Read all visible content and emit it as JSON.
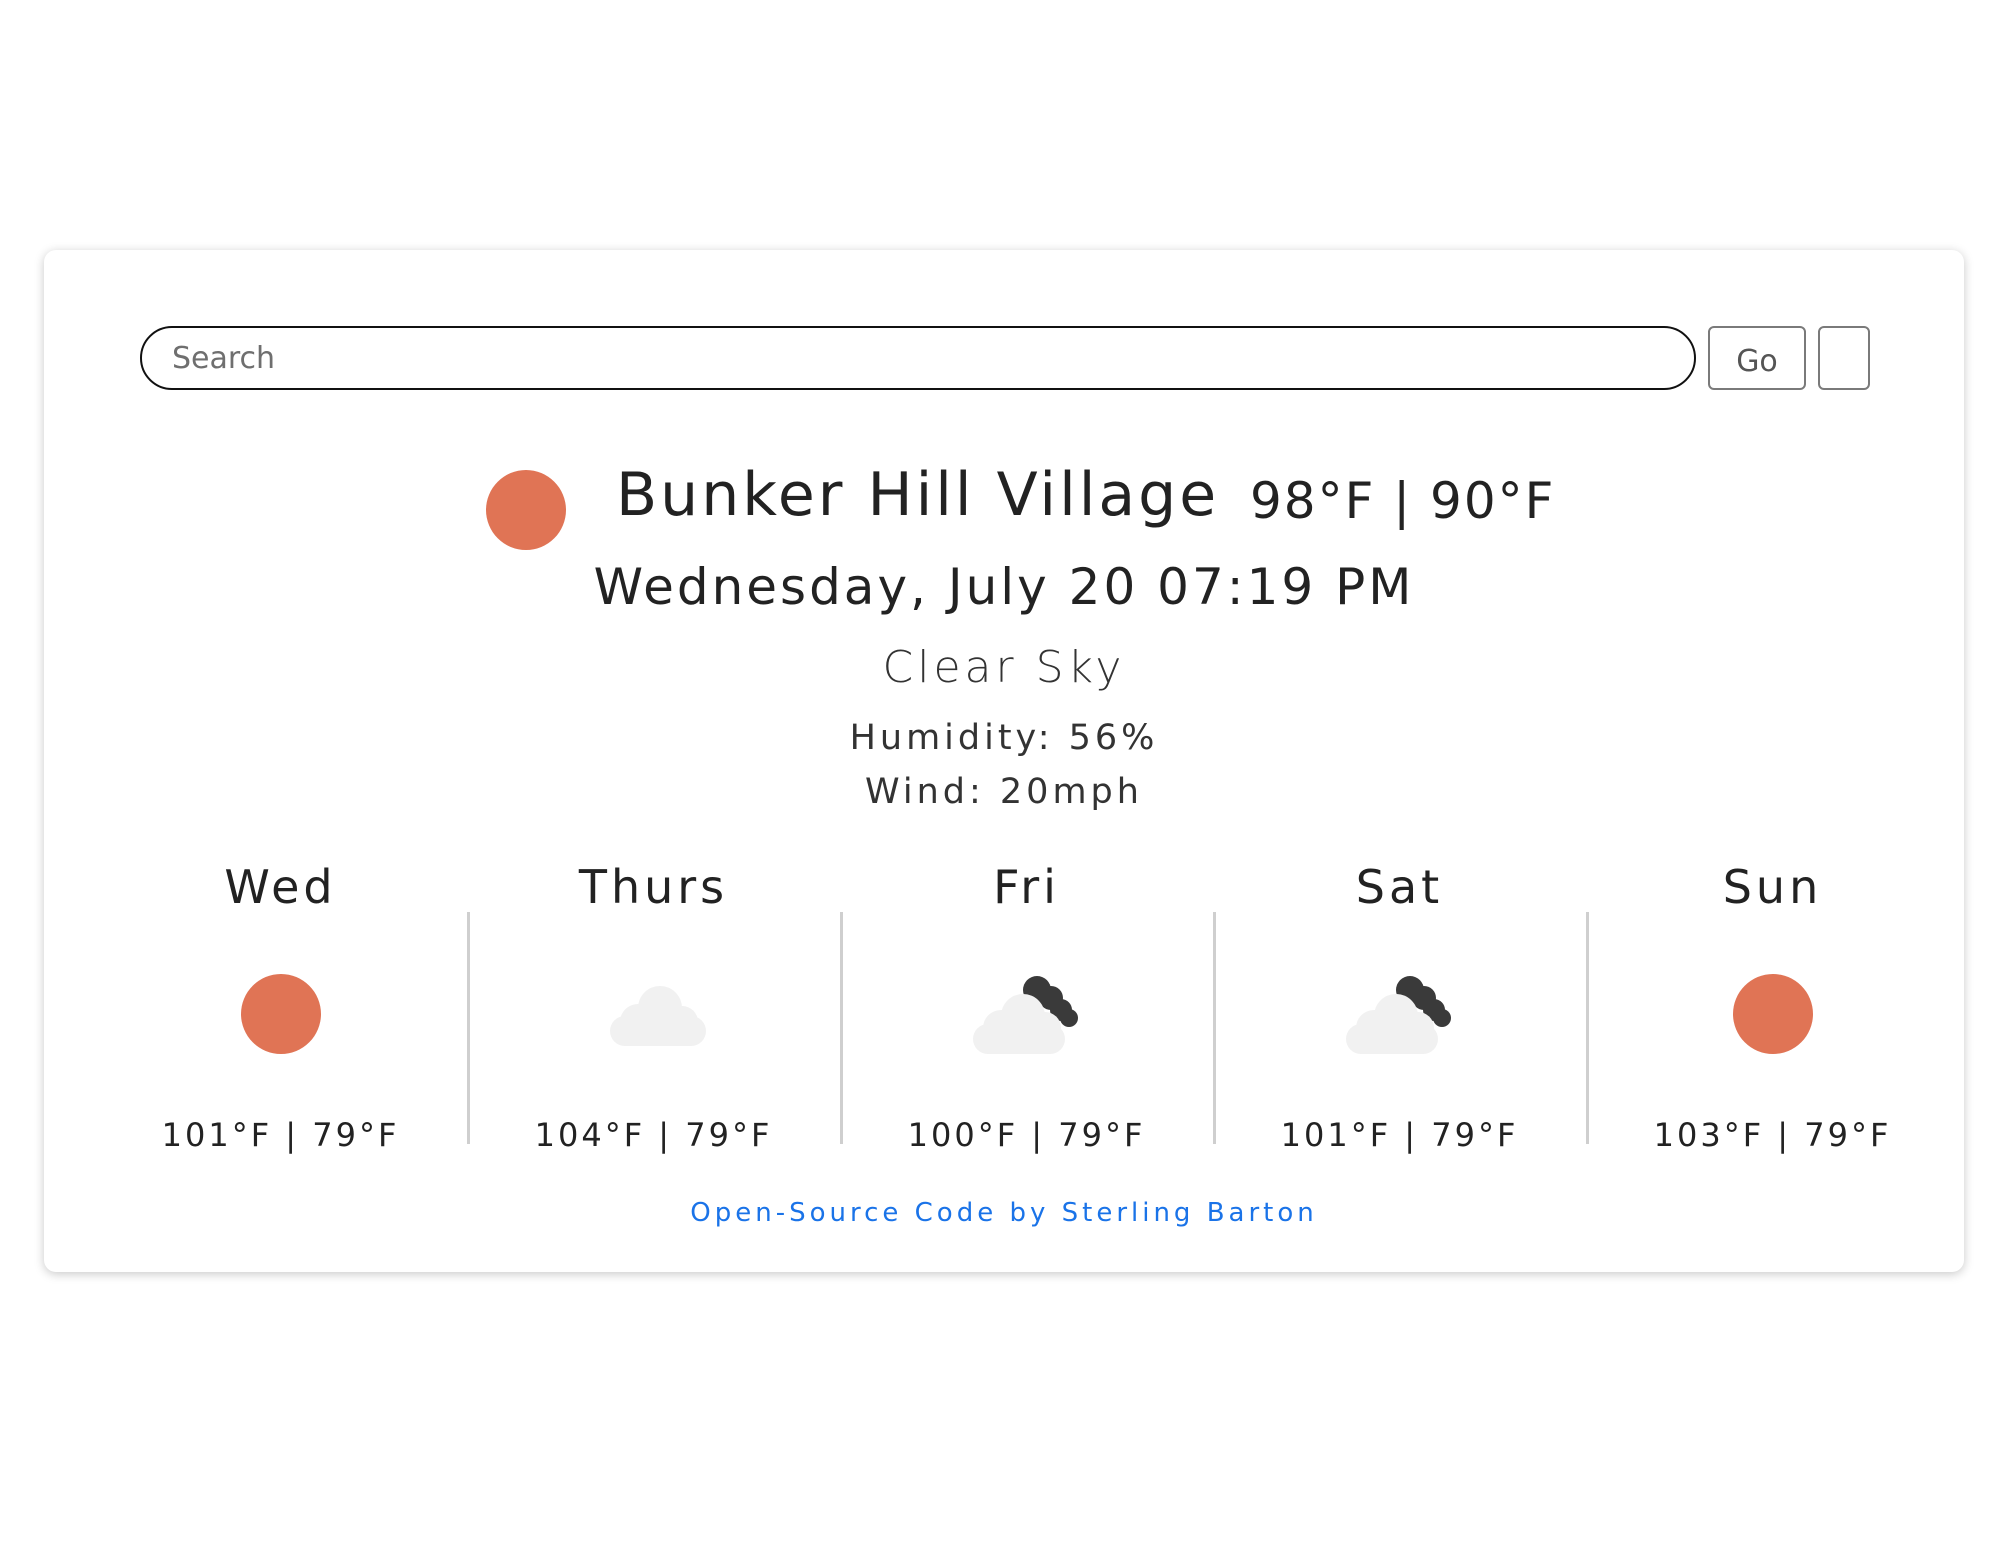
{
  "search": {
    "placeholder": "Search",
    "go_label": "Go"
  },
  "current": {
    "icon": "sun-icon",
    "icon_color": "#e07455",
    "city": "Bunker Hill Village",
    "temps": "98°F | 90°F",
    "datetime": "Wednesday, July 20 07:19 PM",
    "condition": "Clear Sky",
    "humidity": "Humidity: 56%",
    "wind": "Wind: 20mph"
  },
  "forecast": [
    {
      "day": "Wed",
      "icon": "sun-icon",
      "temps": "101°F | 79°F"
    },
    {
      "day": "Thurs",
      "icon": "cloud-icon",
      "temps": "104°F | 79°F"
    },
    {
      "day": "Fri",
      "icon": "night-cloudy-icon",
      "temps": "100°F | 79°F"
    },
    {
      "day": "Sat",
      "icon": "night-cloudy-icon",
      "temps": "101°F | 79°F"
    },
    {
      "day": "Sun",
      "icon": "sun-icon",
      "temps": "103°F | 79°F"
    }
  ],
  "footer": {
    "credit": "Open-Source Code by Sterling Barton"
  },
  "colors": {
    "sun": "#e07455",
    "cloud_light": "#f1f1f1",
    "cloud_dark": "#3a3a3a",
    "link": "#1a73e8"
  }
}
